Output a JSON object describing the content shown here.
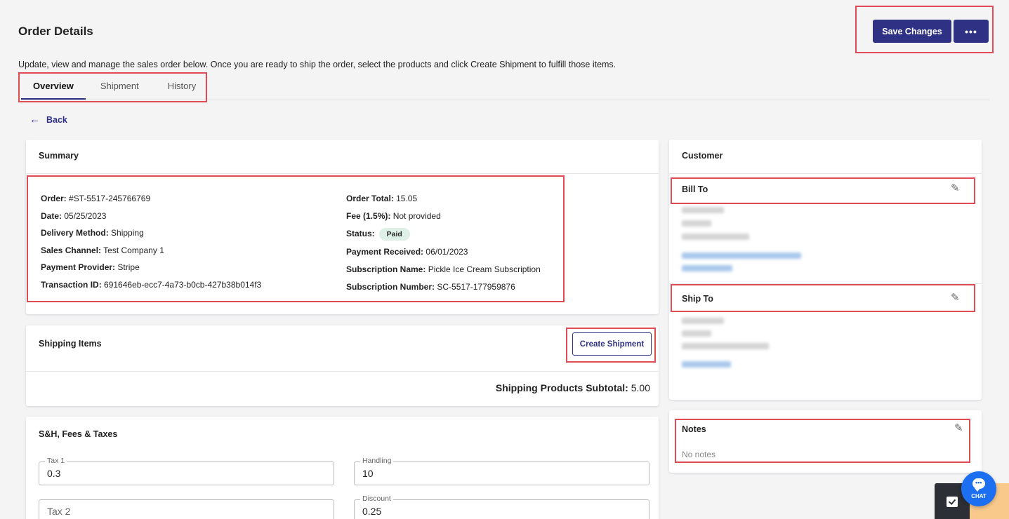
{
  "header": {
    "title": "Order Details",
    "description": "Update, view and manage the sales order below. Once you are ready to ship the order, select the products and click Create Shipment to fulfill those items.",
    "save_label": "Save Changes",
    "more_label": "•••"
  },
  "tabs": [
    {
      "label": "Overview",
      "active": true
    },
    {
      "label": "Shipment",
      "active": false
    },
    {
      "label": "History",
      "active": false
    }
  ],
  "back_label": "Back",
  "summary": {
    "title": "Summary",
    "left": [
      {
        "label": "Order:",
        "value": "#ST-5517-245766769"
      },
      {
        "label": "Date:",
        "value": "05/25/2023"
      },
      {
        "label": "Delivery Method:",
        "value": "Shipping"
      },
      {
        "label": "Sales Channel:",
        "value": "Test Company 1"
      },
      {
        "label": "Payment Provider:",
        "value": "Stripe"
      },
      {
        "label": "Transaction ID:",
        "value": "691646eb-ecc7-4a73-b0cb-427b38b014f3"
      }
    ],
    "right": [
      {
        "label": "Order Total:",
        "value": "15.05"
      },
      {
        "label": "Fee (1.5%):",
        "value": "Not provided"
      },
      {
        "label": "Status:",
        "value": "Paid"
      },
      {
        "label": "Payment Received:",
        "value": "06/01/2023"
      },
      {
        "label": "Subscription Name:",
        "value": "Pickle Ice Cream Subscription"
      },
      {
        "label": "Subscription Number:",
        "value": "SC-5517-177959876"
      }
    ],
    "status_color": "#dff1e6"
  },
  "shipping": {
    "title": "Shipping Items",
    "create_label": "Create Shipment",
    "subtotal_label": "Shipping Products Subtotal:",
    "subtotal_value": "5.00"
  },
  "fees": {
    "title": "S&H, Fees & Taxes",
    "fields": [
      {
        "label": "Tax 1",
        "value": "0.3",
        "placeholder": ""
      },
      {
        "label": "Handling",
        "value": "10",
        "placeholder": ""
      },
      {
        "label": "",
        "value": "",
        "placeholder": "Tax 2"
      },
      {
        "label": "Discount",
        "value": "0.25",
        "placeholder": ""
      }
    ]
  },
  "customer": {
    "title": "Customer",
    "bill_to": "Bill To",
    "ship_to": "Ship To"
  },
  "notes": {
    "title": "Notes",
    "text": "No notes"
  },
  "chat_label": "CHAT",
  "colors": {
    "primary": "#2f3185",
    "highlight": "#e14b55",
    "chat": "#1d6ff2"
  }
}
